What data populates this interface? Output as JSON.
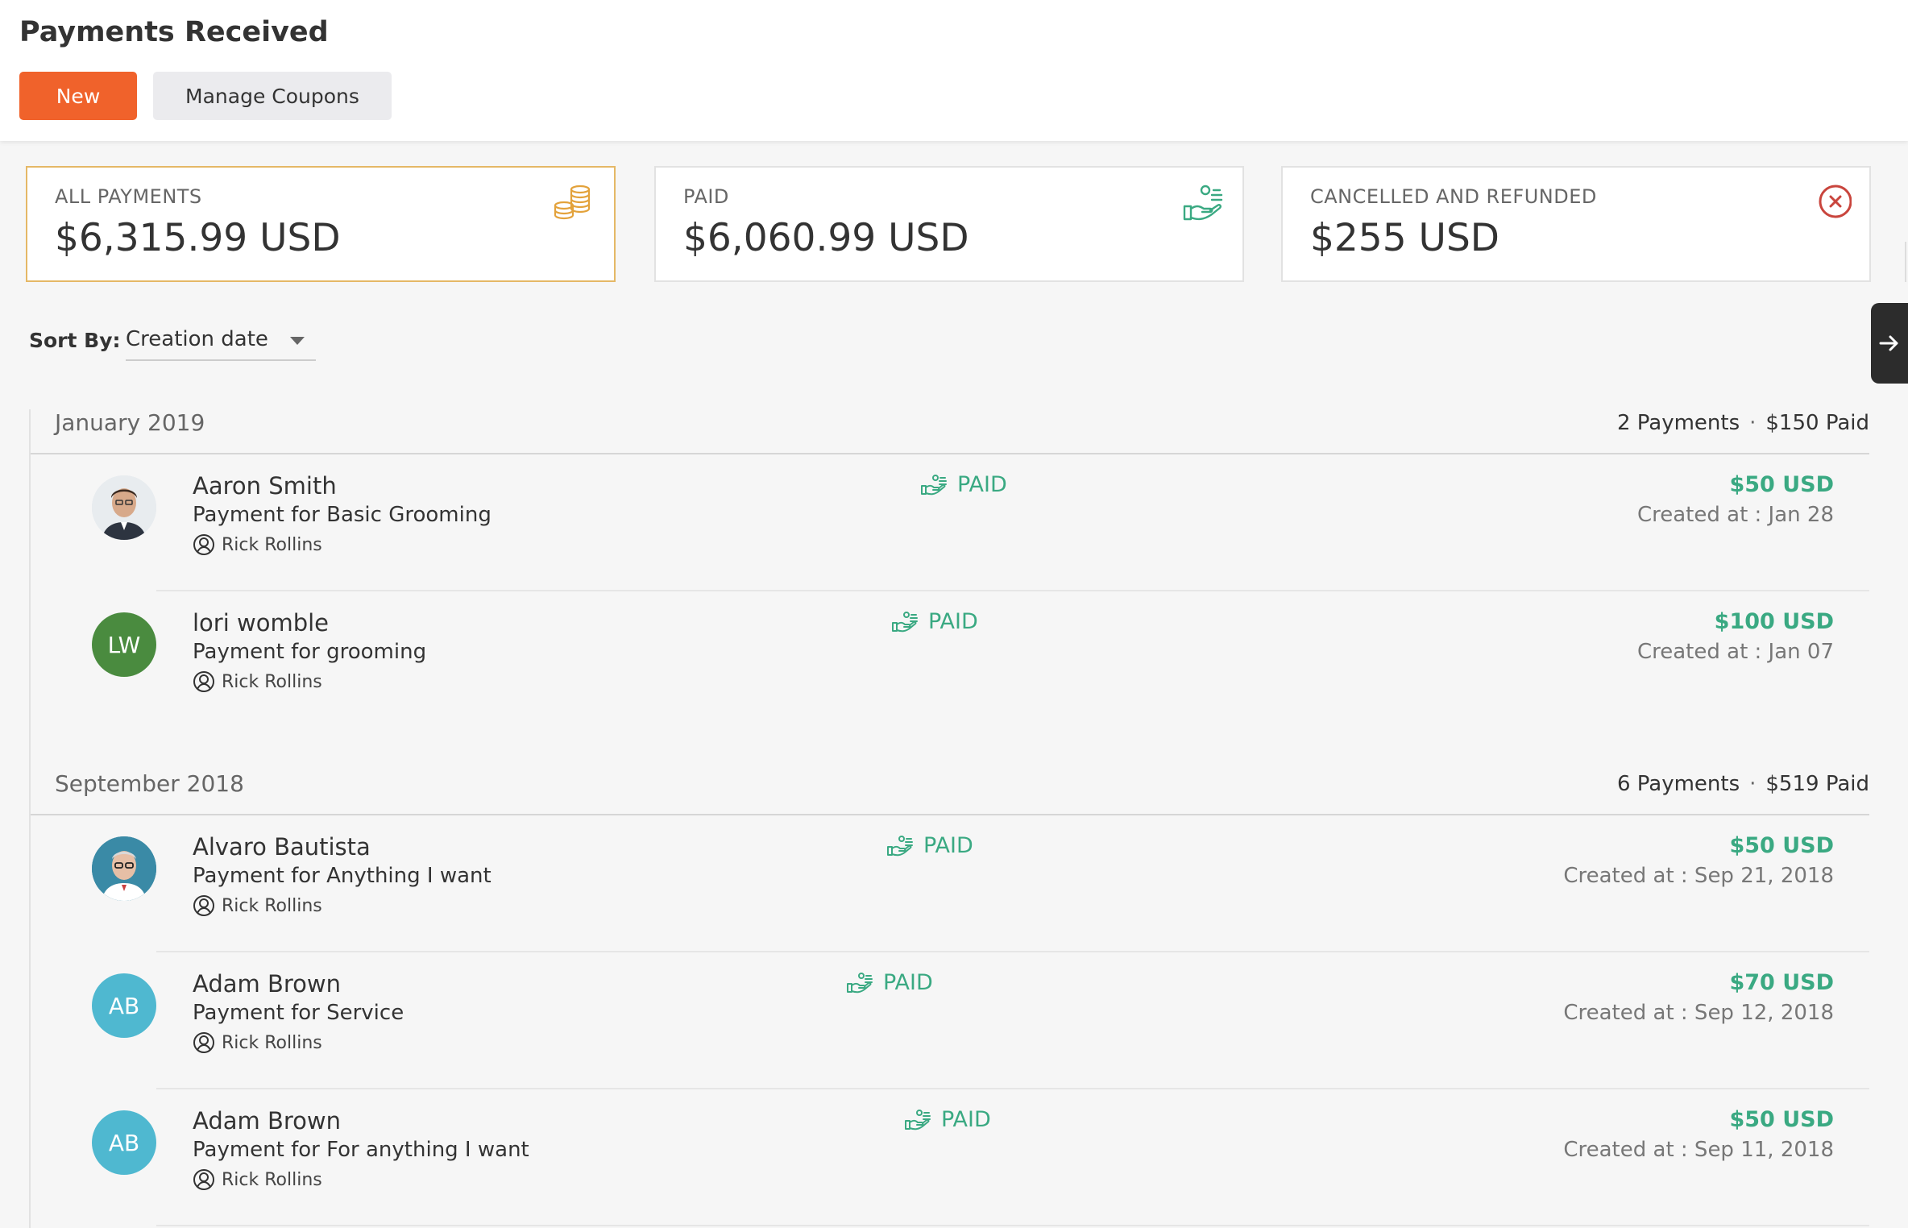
{
  "header": {
    "title": "Payments Received",
    "new_label": "New",
    "coupons_label": "Manage Coupons",
    "accent": "#f0622b"
  },
  "summary": {
    "all": {
      "label": "ALL PAYMENTS",
      "value": "$6,315.99 USD",
      "icon": "coins-icon"
    },
    "paid": {
      "label": "PAID",
      "value": "$6,060.99 USD",
      "icon": "hand-money-icon"
    },
    "cancelled": {
      "label": "CANCELLED AND REFUNDED",
      "value": "$255 USD",
      "icon": "circle-x-icon"
    }
  },
  "sort": {
    "label": "Sort By:",
    "value": "Creation date"
  },
  "groups": [
    {
      "title": "January 2019",
      "count": "2 Payments",
      "paid": "$150 Paid",
      "rows": [
        {
          "name": "Aaron Smith",
          "desc": "Payment for Basic Grooming",
          "staff": "Rick Rollins",
          "status": "PAID",
          "amount": "$50 USD",
          "created": "Created at : Jan 28",
          "avatar": "photo"
        },
        {
          "name": "lori womble",
          "desc": "Payment for grooming",
          "staff": "Rick Rollins",
          "status": "PAID",
          "amount": "$100 USD",
          "created": "Created at : Jan 07",
          "initials": "LW",
          "avatar_color": "#4a8b3f"
        }
      ]
    },
    {
      "title": "September 2018",
      "count": "6 Payments",
      "paid": "$519 Paid",
      "rows": [
        {
          "name": "Alvaro Bautista",
          "desc": "Payment for Anything I want",
          "staff": "Rick Rollins",
          "status": "PAID",
          "amount": "$50 USD",
          "created": "Created at : Sep 21, 2018",
          "avatar": "photo"
        },
        {
          "name": "Adam Brown",
          "desc": "Payment for Service",
          "staff": "Rick Rollins",
          "status": "PAID",
          "amount": "$70 USD",
          "created": "Created at : Sep 12, 2018",
          "initials": "AB",
          "avatar_color": "#4fb8d0"
        },
        {
          "name": "Adam Brown",
          "desc": "Payment for For anything I want",
          "staff": "Rick Rollins",
          "status": "PAID",
          "amount": "$50 USD",
          "created": "Created at : Sep 11, 2018",
          "initials": "AB",
          "avatar_color": "#4fb8d0"
        }
      ]
    }
  ],
  "colors": {
    "paid_green": "#3aa982",
    "coins_gold": "#e3a23b",
    "cancel_red": "#c9453d"
  }
}
